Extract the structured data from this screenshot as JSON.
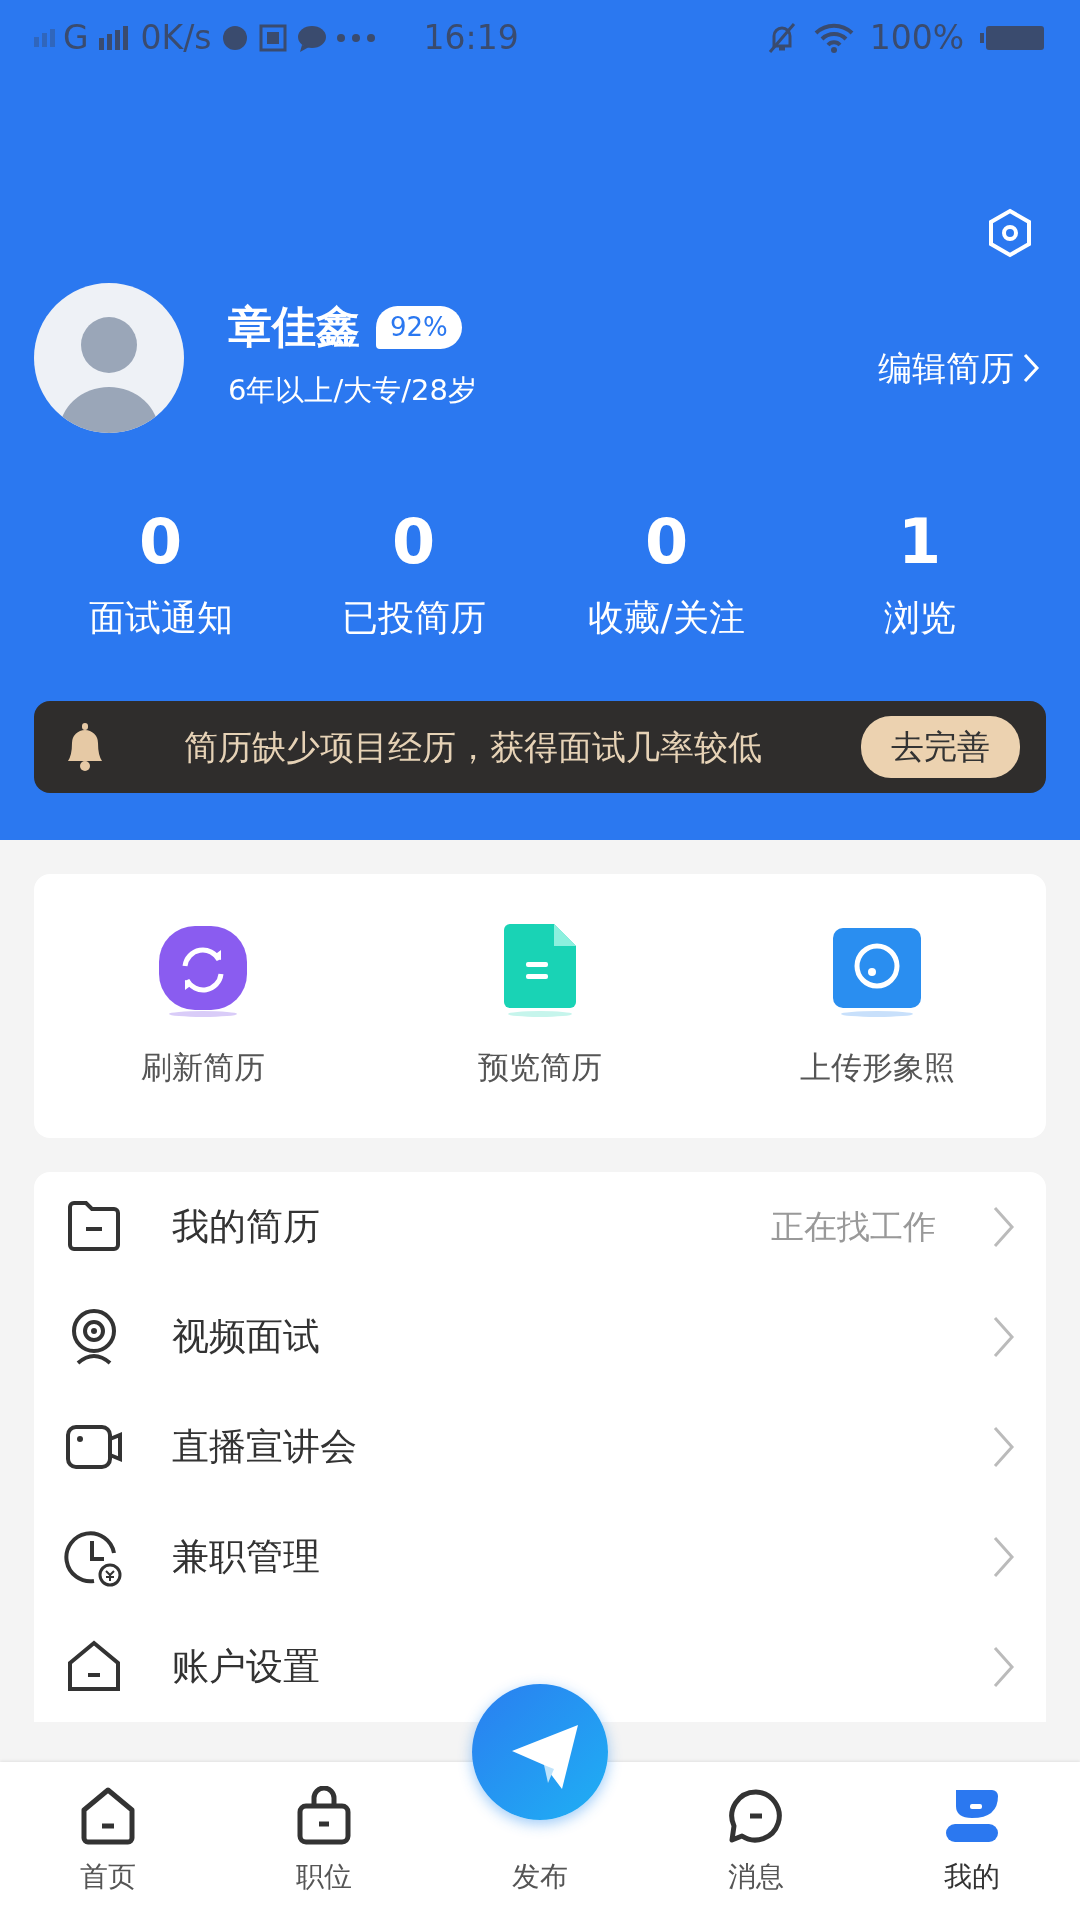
{
  "status_bar": {
    "network": "G",
    "speed": "0K/s",
    "time": "16:19",
    "battery": "100%"
  },
  "profile": {
    "name": "章佳鑫",
    "completeness": "92%",
    "summary": "6年以上/大专/28岁",
    "edit_label": "编辑简历"
  },
  "stats": [
    {
      "value": "0",
      "label": "面试通知"
    },
    {
      "value": "0",
      "label": "已投简历"
    },
    {
      "value": "0",
      "label": "收藏/关注"
    },
    {
      "value": "1",
      "label": "浏览"
    }
  ],
  "notice": {
    "text": "简历缺少项目经历，获得面试几率较低",
    "action": "去完善"
  },
  "quick_actions": [
    {
      "label": "刷新简历",
      "kind": "refresh"
    },
    {
      "label": "预览简历",
      "kind": "preview"
    },
    {
      "label": "上传形象照",
      "kind": "photo"
    }
  ],
  "menu": [
    {
      "label": "我的简历",
      "kind": "folder",
      "value": "正在找工作"
    },
    {
      "label": "视频面试",
      "kind": "webcam"
    },
    {
      "label": "直播宣讲会",
      "kind": "camera"
    },
    {
      "label": "兼职管理",
      "kind": "clock"
    },
    {
      "label": "账户设置",
      "kind": "home"
    }
  ],
  "tabs": [
    {
      "label": "首页",
      "kind": "home",
      "selected": false
    },
    {
      "label": "职位",
      "kind": "bag",
      "selected": false
    },
    {
      "label": "发布",
      "kind": "publish",
      "selected": false
    },
    {
      "label": "消息",
      "kind": "chat",
      "selected": false
    },
    {
      "label": "我的",
      "kind": "user",
      "selected": true
    }
  ]
}
